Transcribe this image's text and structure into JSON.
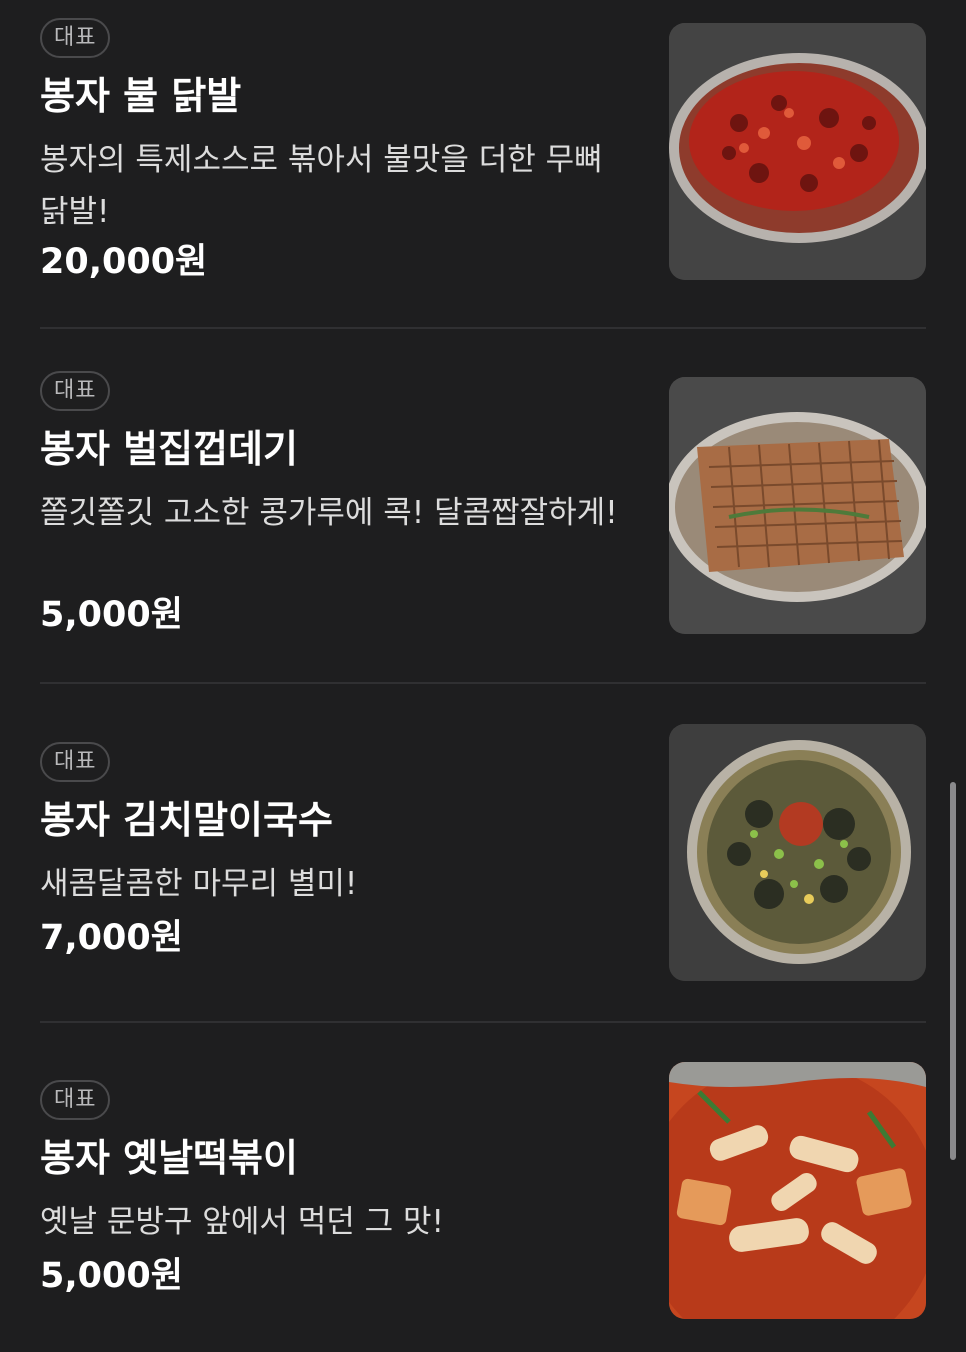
{
  "menu": {
    "items": [
      {
        "badge": "대표",
        "name": "봉자 불 닭발",
        "description": "봉자의 특제소스로 볶아서 불맛을 더한 무뼈닭발!",
        "price": "20,000원",
        "image": "spicy-chicken-feet-photo"
      },
      {
        "badge": "대표",
        "name": "봉자 벌집껍데기",
        "description": "쫄깃쫄깃 고소한 콩가루에 콕! 달콤짭잘하게!",
        "price": "5,000원",
        "image": "honeycomb-pork-skin-photo"
      },
      {
        "badge": "대표",
        "name": "봉자 김치말이국수",
        "description": "새콤달콤한 마무리 별미!",
        "price": "7,000원",
        "image": "kimchi-noodle-soup-photo"
      },
      {
        "badge": "대표",
        "name": "봉자 옛날떡볶이",
        "description": "옛날 문방구 앞에서 먹던 그 맛!",
        "price": "5,000원",
        "image": "tteokbokki-photo"
      }
    ]
  },
  "colors": {
    "background": "#1e1e1f",
    "badge_border": "#4a4a4c",
    "divider": "#303032"
  }
}
